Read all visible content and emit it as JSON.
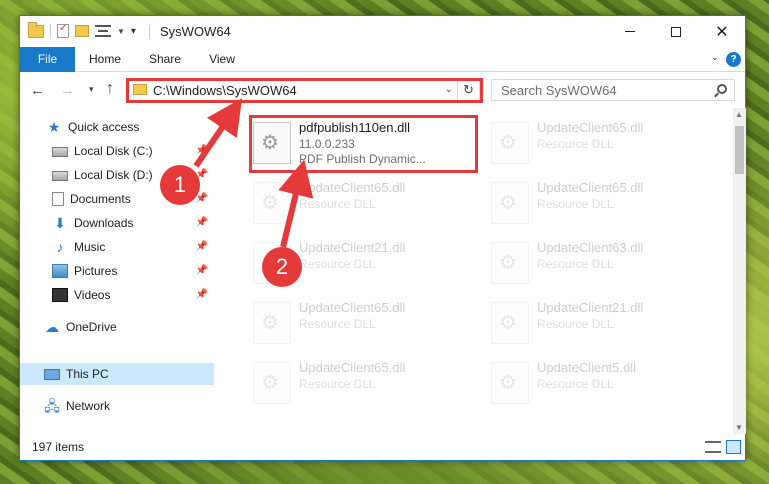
{
  "window": {
    "title": "SysWOW64"
  },
  "ribbon": {
    "tabs": [
      "File",
      "Home",
      "Share",
      "View"
    ],
    "help": "?"
  },
  "nav": {
    "address": "C:\\Windows\\SysWOW64",
    "search_placeholder": "Search SysWOW64"
  },
  "sidebar": {
    "items": [
      {
        "label": "Quick access",
        "icon": "star-icon"
      },
      {
        "label": "Local Disk (C:)",
        "icon": "disk-icon"
      },
      {
        "label": "Local Disk (D:)",
        "icon": "disk-icon"
      },
      {
        "label": "Documents",
        "icon": "documents-icon"
      },
      {
        "label": "Downloads",
        "icon": "downloads-icon"
      },
      {
        "label": "Music",
        "icon": "music-icon"
      },
      {
        "label": "Pictures",
        "icon": "pictures-icon"
      },
      {
        "label": "Videos",
        "icon": "videos-icon"
      },
      {
        "label": "OneDrive",
        "icon": "onedrive-icon"
      },
      {
        "label": "This PC",
        "icon": "pc-icon"
      },
      {
        "label": "Network",
        "icon": "network-icon"
      }
    ]
  },
  "files": {
    "highlighted": {
      "name": "pdfpublish110en.dll",
      "version": "11.0.0.233",
      "description": "PDF Publish Dynamic..."
    },
    "faded": [
      {
        "name": "UpdateClient65.dll",
        "type": "Resource DLL"
      },
      {
        "name": "UpdateClient65.dll",
        "type": "Resource DLL"
      },
      {
        "name": "UpdateClient65.dll",
        "type": "Resource DLL"
      },
      {
        "name": "UpdateClient21.dll",
        "type": "Resource DLL"
      },
      {
        "name": "UpdateClient63.dll",
        "type": "Resource DLL"
      },
      {
        "name": "UpdateClient65.dll",
        "type": "Resource DLL"
      },
      {
        "name": "UpdateClient21.dll",
        "type": "Resource DLL"
      },
      {
        "name": "UpdateClient65.dll",
        "type": "Resource DLL"
      },
      {
        "name": "UpdateClient5.dll",
        "type": "Resource DLL"
      }
    ]
  },
  "status": {
    "items": "197 items"
  },
  "annotations": {
    "step1": "1",
    "step2": "2",
    "color": "#e63a3a"
  }
}
